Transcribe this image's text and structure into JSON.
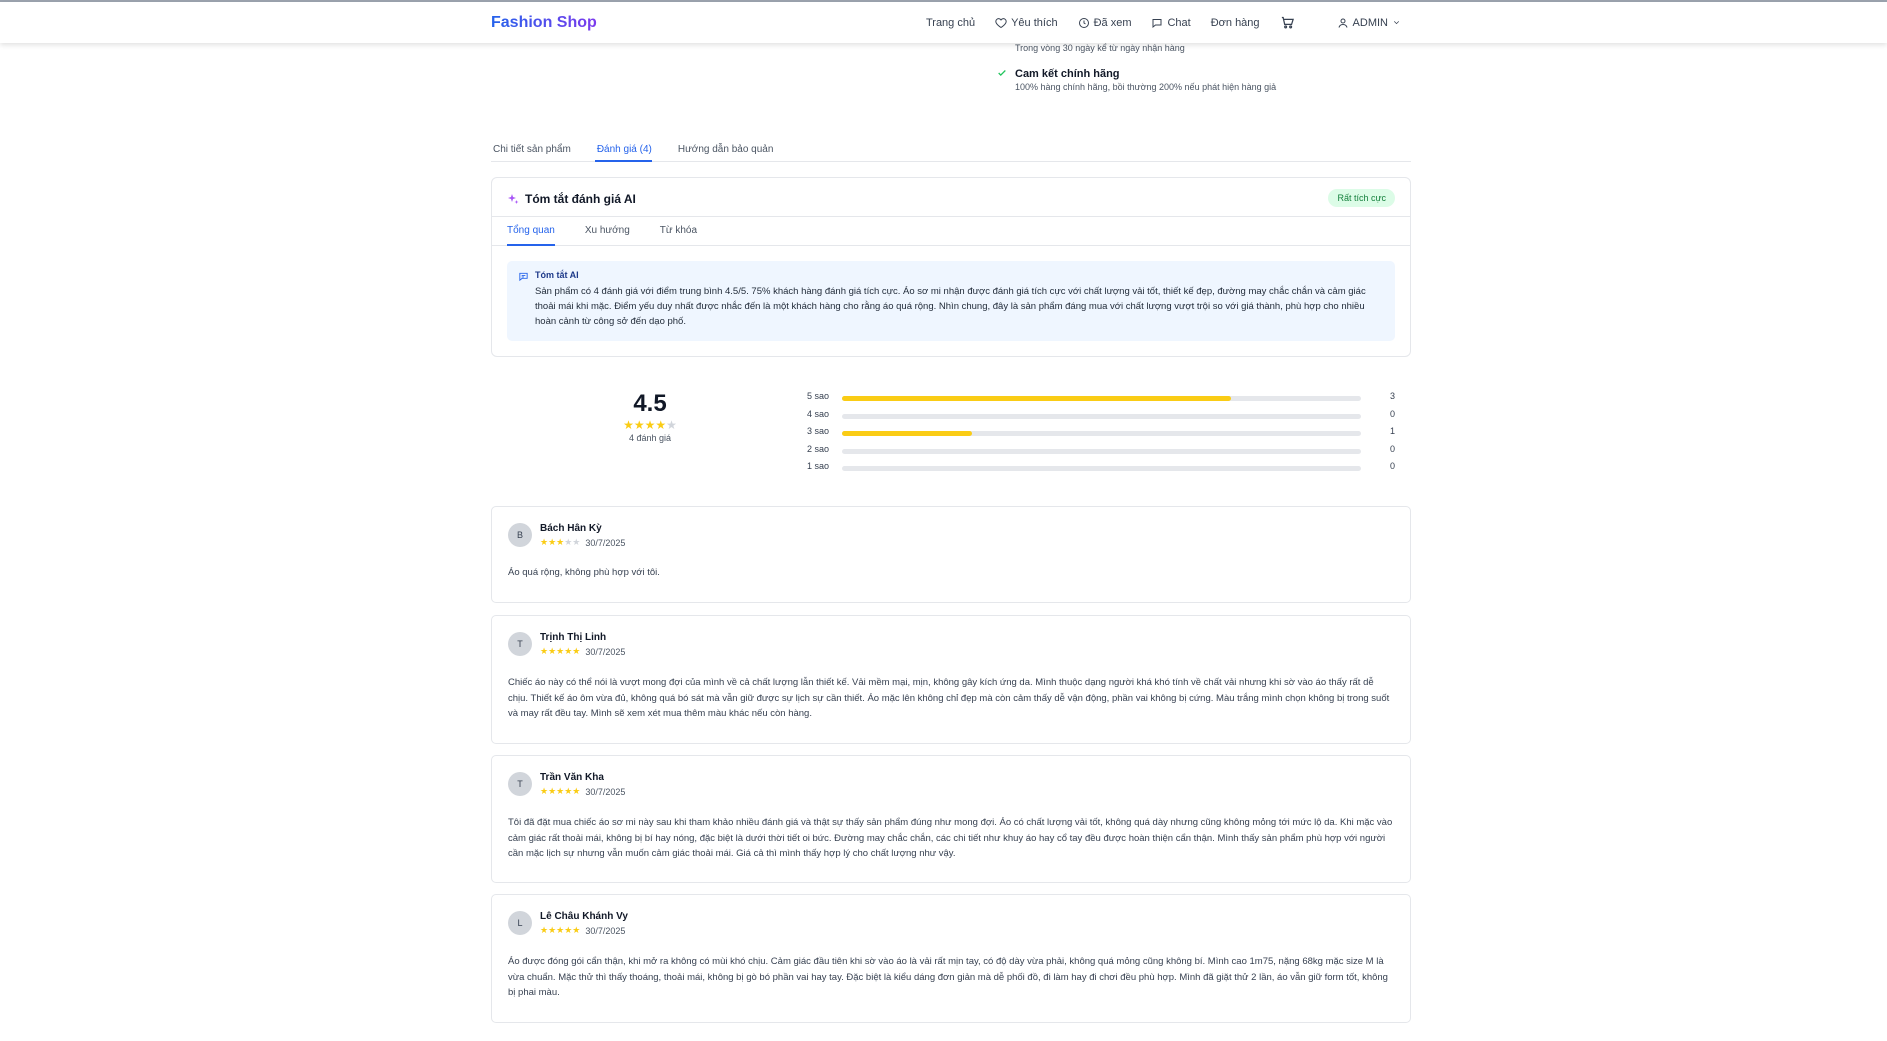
{
  "nav": {
    "brand": "Fashion Shop",
    "home": "Trang chủ",
    "favorites": "Yêu thích",
    "viewed": "Đã xem",
    "chat": "Chat",
    "orders": "Đơn hàng",
    "user": "ADMIN"
  },
  "features": [
    {
      "title": "",
      "subtitle": "Trong vòng 30 ngày kể từ ngày nhận hàng"
    },
    {
      "title": "Cam kết chính hãng",
      "subtitle": "100% hàng chính hãng, bồi thường 200% nếu phát hiện hàng giả"
    }
  ],
  "product_tabs": [
    "Chi tiết sản phẩm",
    "Đánh giá (4)",
    "Hướng dẫn bảo quản"
  ],
  "ai_summary": {
    "title": "Tóm tắt đánh giá AI",
    "badge": "Rất tích cực",
    "tabs": [
      "Tổng quan",
      "Xu hướng",
      "Từ khóa"
    ],
    "box_title": "Tóm tắt AI",
    "box_text": "Sản phẩm có 4 đánh giá với điểm trung bình 4.5/5. 75% khách hàng đánh giá tích cực. Áo sơ mi nhận được đánh giá tích cực với chất lượng vải tốt, thiết kế đẹp, đường may chắc chắn và cảm giác thoải mái khi mặc. Điểm yếu duy nhất được nhắc đến là một khách hàng cho rằng áo quá rộng. Nhìn chung, đây là sản phẩm đáng mua với chất lượng vượt trội so với giá thành, phù hợp cho nhiều hoàn cảnh từ công sở đến dạo phố."
  },
  "rating": {
    "average": "4.5",
    "stars_filled": 4,
    "count_label": "4 đánh giá",
    "distribution": [
      {
        "label": "5 sao",
        "count": 3,
        "fraction": 0.75
      },
      {
        "label": "4 sao",
        "count": 0,
        "fraction": 0
      },
      {
        "label": "3 sao",
        "count": 1,
        "fraction": 0.25
      },
      {
        "label": "2 sao",
        "count": 0,
        "fraction": 0
      },
      {
        "label": "1 sao",
        "count": 0,
        "fraction": 0
      }
    ]
  },
  "reviews": [
    {
      "initial": "B",
      "name": "Bách Hân Kỳ",
      "stars": 3,
      "date": "30/7/2025",
      "text": "Áo quá rộng, không phù hợp với tôi."
    },
    {
      "initial": "T",
      "name": "Trịnh Thị Linh",
      "stars": 5,
      "date": "30/7/2025",
      "text": "Chiếc áo này có thể nói là vượt mong đợi của mình về cả chất lượng lẫn thiết kế. Vải mềm mại, mịn, không gây kích ứng da. Mình thuộc dạng người khá khó tính về chất vải nhưng khi sờ vào áo thấy rất dễ chịu. Thiết kế áo ôm vừa đủ, không quá bó sát mà vẫn giữ được sự lịch sự cần thiết. Áo mặc lên không chỉ đẹp mà còn cảm thấy dễ vận động, phần vai không bị cứng. Màu trắng mình chọn không bị trong suốt và may rất đều tay. Mình sẽ xem xét mua thêm màu khác nếu còn hàng."
    },
    {
      "initial": "T",
      "name": "Trần Văn Kha",
      "stars": 5,
      "date": "30/7/2025",
      "text": "Tôi đã đặt mua chiếc áo sơ mi này sau khi tham khảo nhiều đánh giá và thật sự thấy sản phẩm đúng như mong đợi. Áo có chất lượng vải tốt, không quá dày nhưng cũng không mỏng tới mức lộ da. Khi mặc vào cảm giác rất thoải mái, không bị bí hay nóng, đặc biệt là dưới thời tiết oi bức. Đường may chắc chắn, các chi tiết như khuy áo hay cổ tay đều được hoàn thiện cẩn thận. Mình thấy sản phẩm phù hợp với người cần mặc lịch sự nhưng vẫn muốn cảm giác thoải mái. Giá cả thì mình thấy hợp lý cho chất lượng như vậy."
    },
    {
      "initial": "L",
      "name": "Lê Châu Khánh Vy",
      "stars": 5,
      "date": "30/7/2025",
      "text": "Áo được đóng gói cẩn thận, khi mở ra không có mùi khó chịu. Cảm giác đầu tiên khi sờ vào áo là vải rất mịn tay, có độ dày vừa phải, không quá mỏng cũng không bí. Mình cao 1m75, nặng 68kg mặc size M là vừa chuẩn. Mặc thử thì thấy thoáng, thoải mái, không bị gò bó phần vai hay tay. Đặc biệt là kiểu dáng đơn giản mà dễ phối đồ, đi làm hay đi chơi đều phù hợp. Mình đã giặt thử 2 lần, áo vẫn giữ form tốt, không bị phai màu."
    }
  ],
  "colors": {
    "accent": "#2563eb",
    "star": "#facc15",
    "badge_bg": "#dcfce7",
    "badge_text": "#15803d",
    "ai_box_bg": "#eff6ff"
  }
}
